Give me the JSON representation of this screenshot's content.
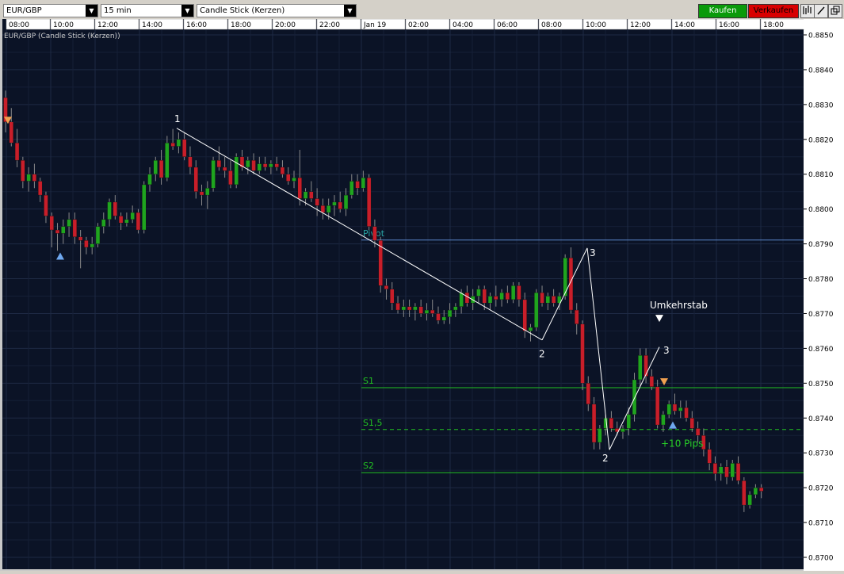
{
  "toolbar": {
    "symbol": "EUR/GBP",
    "interval": "15 min",
    "chart_type": "Candle Stick (Kerzen)",
    "buy_label": "Kaufen",
    "sell_label": "Verkaufen",
    "buy_color": "#0a9a0a",
    "sell_color": "#d80000",
    "icons": [
      "candles-icon",
      "pencil-icon",
      "popout-icon"
    ]
  },
  "chart_data": {
    "type": "candlestick",
    "title": "EUR/GBP (Candle Stick (Kerzen))",
    "background": "#0b1326",
    "up_color": "#1fa51f",
    "down_color": "#c81e2a",
    "x_ticks": [
      "08:00",
      "10:00",
      "12:00",
      "14:00",
      "16:00",
      "18:00",
      "20:00",
      "22:00",
      "Jan 19",
      "02:00",
      "04:00",
      "06:00",
      "08:00",
      "10:00",
      "12:00",
      "14:00",
      "16:00",
      "18:00"
    ],
    "y_ticks": [
      "0.8850",
      "0.8840",
      "0.8830",
      "0.8820",
      "0.8810",
      "0.8800",
      "0.8790",
      "0.8780",
      "0.8770",
      "0.8760",
      "0.8750",
      "0.8740",
      "0.8730",
      "0.8720",
      "0.8710",
      "0.8700"
    ],
    "ylim": [
      0.8698,
      0.8852
    ],
    "grid": true,
    "levels": [
      {
        "label": "Pivot",
        "value": 0.87911,
        "color": "#5b86c9",
        "dashed": false,
        "label_color": "#2aa6a6"
      },
      {
        "label": "S1",
        "value": 0.87487,
        "color": "#22c022",
        "dashed": false,
        "label_color": "#22c022"
      },
      {
        "label": "S1,5",
        "value": 0.87367,
        "color": "#22c022",
        "dashed": true,
        "label_color": "#22c022"
      },
      {
        "label": "S2",
        "value": 0.87243,
        "color": "#22c022",
        "dashed": false,
        "label_color": "#22c022"
      }
    ],
    "annotations": [
      {
        "text": "1",
        "x": "15:00",
        "value": 0.8825
      },
      {
        "text": "2",
        "x": "08:00 (Jan 19)",
        "value": 0.8759
      },
      {
        "text": "3",
        "x": "10:00 (Jan 19)",
        "value": 0.8789
      },
      {
        "text": "2",
        "x": "10:45 (Jan 19)",
        "value": 0.8728
      },
      {
        "text": "3",
        "x": "13:00 (Jan 19)",
        "value": 0.8761
      },
      {
        "text": "Umkehrstab",
        "x": "13:15 (Jan 19)",
        "value": 0.8768
      },
      {
        "text": "+10 Pips",
        "x": "14:30 (Jan 19)",
        "value": 0.8734
      }
    ],
    "zigzag": [
      [
        0.88232,
        0.87624
      ],
      [
        0.87624,
        0.87888
      ],
      [
        0.87888,
        0.87309
      ],
      [
        0.87309,
        0.87604
      ]
    ],
    "candles": [
      {
        "o": 0.8832,
        "h": 0.8834,
        "l": 0.8822,
        "c": 0.8825
      },
      {
        "o": 0.8825,
        "h": 0.8829,
        "l": 0.8818,
        "c": 0.8819
      },
      {
        "o": 0.8819,
        "h": 0.8823,
        "l": 0.8812,
        "c": 0.8814
      },
      {
        "o": 0.8814,
        "h": 0.8815,
        "l": 0.8806,
        "c": 0.8808
      },
      {
        "o": 0.8808,
        "h": 0.8812,
        "l": 0.8805,
        "c": 0.881
      },
      {
        "o": 0.881,
        "h": 0.8813,
        "l": 0.8806,
        "c": 0.8808
      },
      {
        "o": 0.8808,
        "h": 0.8809,
        "l": 0.8802,
        "c": 0.8804
      },
      {
        "o": 0.8804,
        "h": 0.8805,
        "l": 0.8796,
        "c": 0.8798
      },
      {
        "o": 0.8798,
        "h": 0.8799,
        "l": 0.8789,
        "c": 0.8794
      },
      {
        "o": 0.8794,
        "h": 0.8796,
        "l": 0.8788,
        "c": 0.8793
      },
      {
        "o": 0.8793,
        "h": 0.8797,
        "l": 0.879,
        "c": 0.8795
      },
      {
        "o": 0.8795,
        "h": 0.8799,
        "l": 0.8792,
        "c": 0.8797
      },
      {
        "o": 0.8797,
        "h": 0.8799,
        "l": 0.879,
        "c": 0.8792
      },
      {
        "o": 0.8792,
        "h": 0.8794,
        "l": 0.8783,
        "c": 0.8791
      },
      {
        "o": 0.8791,
        "h": 0.8792,
        "l": 0.8787,
        "c": 0.8789
      },
      {
        "o": 0.8789,
        "h": 0.8792,
        "l": 0.8787,
        "c": 0.879
      },
      {
        "o": 0.879,
        "h": 0.8796,
        "l": 0.8789,
        "c": 0.8795
      },
      {
        "o": 0.8795,
        "h": 0.8799,
        "l": 0.8793,
        "c": 0.8797
      },
      {
        "o": 0.8797,
        "h": 0.8803,
        "l": 0.8795,
        "c": 0.8802
      },
      {
        "o": 0.8802,
        "h": 0.8804,
        "l": 0.8797,
        "c": 0.8798
      },
      {
        "o": 0.8798,
        "h": 0.8799,
        "l": 0.8794,
        "c": 0.8796
      },
      {
        "o": 0.8796,
        "h": 0.8799,
        "l": 0.8795,
        "c": 0.8797
      },
      {
        "o": 0.8797,
        "h": 0.8801,
        "l": 0.8796,
        "c": 0.8799
      },
      {
        "o": 0.8799,
        "h": 0.88,
        "l": 0.8793,
        "c": 0.8794
      },
      {
        "o": 0.8794,
        "h": 0.8808,
        "l": 0.8793,
        "c": 0.8807
      },
      {
        "o": 0.8807,
        "h": 0.8812,
        "l": 0.8805,
        "c": 0.881
      },
      {
        "o": 0.881,
        "h": 0.8815,
        "l": 0.8808,
        "c": 0.8814
      },
      {
        "o": 0.8814,
        "h": 0.8817,
        "l": 0.8807,
        "c": 0.8809
      },
      {
        "o": 0.8809,
        "h": 0.8821,
        "l": 0.8808,
        "c": 0.8819
      },
      {
        "o": 0.8819,
        "h": 0.8823,
        "l": 0.8817,
        "c": 0.8818
      },
      {
        "o": 0.8818,
        "h": 0.8822,
        "l": 0.8816,
        "c": 0.882
      },
      {
        "o": 0.882,
        "h": 0.8822,
        "l": 0.8814,
        "c": 0.8815
      },
      {
        "o": 0.8815,
        "h": 0.8818,
        "l": 0.881,
        "c": 0.8812
      },
      {
        "o": 0.8812,
        "h": 0.8814,
        "l": 0.8803,
        "c": 0.8805
      },
      {
        "o": 0.8805,
        "h": 0.8807,
        "l": 0.8801,
        "c": 0.8804
      },
      {
        "o": 0.8804,
        "h": 0.8808,
        "l": 0.88,
        "c": 0.8806
      },
      {
        "o": 0.8806,
        "h": 0.8815,
        "l": 0.8805,
        "c": 0.8814
      },
      {
        "o": 0.8814,
        "h": 0.8818,
        "l": 0.8811,
        "c": 0.8812
      },
      {
        "o": 0.8812,
        "h": 0.8815,
        "l": 0.8809,
        "c": 0.8811
      },
      {
        "o": 0.8811,
        "h": 0.8814,
        "l": 0.8806,
        "c": 0.8807
      },
      {
        "o": 0.8807,
        "h": 0.8816,
        "l": 0.8806,
        "c": 0.8815
      },
      {
        "o": 0.8815,
        "h": 0.8817,
        "l": 0.8811,
        "c": 0.8812
      },
      {
        "o": 0.8812,
        "h": 0.8815,
        "l": 0.881,
        "c": 0.8814
      },
      {
        "o": 0.8814,
        "h": 0.8816,
        "l": 0.881,
        "c": 0.8811
      },
      {
        "o": 0.8811,
        "h": 0.8815,
        "l": 0.881,
        "c": 0.8813
      },
      {
        "o": 0.8813,
        "h": 0.8815,
        "l": 0.8811,
        "c": 0.8812
      },
      {
        "o": 0.8812,
        "h": 0.8814,
        "l": 0.881,
        "c": 0.8813
      },
      {
        "o": 0.8813,
        "h": 0.8815,
        "l": 0.8811,
        "c": 0.8812
      },
      {
        "o": 0.8812,
        "h": 0.8814,
        "l": 0.8809,
        "c": 0.881
      },
      {
        "o": 0.881,
        "h": 0.8812,
        "l": 0.8807,
        "c": 0.8808
      },
      {
        "o": 0.8808,
        "h": 0.8811,
        "l": 0.8806,
        "c": 0.8809
      },
      {
        "o": 0.8809,
        "h": 0.8817,
        "l": 0.8801,
        "c": 0.8803
      },
      {
        "o": 0.8803,
        "h": 0.8806,
        "l": 0.8801,
        "c": 0.8805
      },
      {
        "o": 0.8805,
        "h": 0.8808,
        "l": 0.8802,
        "c": 0.8803
      },
      {
        "o": 0.8803,
        "h": 0.8806,
        "l": 0.8798,
        "c": 0.8801
      },
      {
        "o": 0.8801,
        "h": 0.8803,
        "l": 0.8797,
        "c": 0.8799
      },
      {
        "o": 0.8799,
        "h": 0.8803,
        "l": 0.8797,
        "c": 0.8801
      },
      {
        "o": 0.8801,
        "h": 0.8804,
        "l": 0.8798,
        "c": 0.8802
      },
      {
        "o": 0.8802,
        "h": 0.8805,
        "l": 0.8799,
        "c": 0.88
      },
      {
        "o": 0.88,
        "h": 0.8806,
        "l": 0.8798,
        "c": 0.8804
      },
      {
        "o": 0.8804,
        "h": 0.881,
        "l": 0.8803,
        "c": 0.8808
      },
      {
        "o": 0.8808,
        "h": 0.881,
        "l": 0.8804,
        "c": 0.8806
      },
      {
        "o": 0.8806,
        "h": 0.8811,
        "l": 0.8805,
        "c": 0.8809
      },
      {
        "o": 0.8809,
        "h": 0.881,
        "l": 0.8794,
        "c": 0.8795
      },
      {
        "o": 0.8795,
        "h": 0.8797,
        "l": 0.8789,
        "c": 0.8791
      },
      {
        "o": 0.8791,
        "h": 0.8792,
        "l": 0.8776,
        "c": 0.8778
      },
      {
        "o": 0.8778,
        "h": 0.878,
        "l": 0.8774,
        "c": 0.8777
      },
      {
        "o": 0.8777,
        "h": 0.8779,
        "l": 0.8771,
        "c": 0.8773
      },
      {
        "o": 0.8773,
        "h": 0.8775,
        "l": 0.877,
        "c": 0.8771
      },
      {
        "o": 0.8771,
        "h": 0.8774,
        "l": 0.8769,
        "c": 0.8772
      },
      {
        "o": 0.8772,
        "h": 0.8774,
        "l": 0.8769,
        "c": 0.8771
      },
      {
        "o": 0.8771,
        "h": 0.8773,
        "l": 0.8768,
        "c": 0.8772
      },
      {
        "o": 0.8772,
        "h": 0.8774,
        "l": 0.8769,
        "c": 0.877
      },
      {
        "o": 0.877,
        "h": 0.8773,
        "l": 0.8768,
        "c": 0.8771
      },
      {
        "o": 0.8771,
        "h": 0.8774,
        "l": 0.8769,
        "c": 0.877
      },
      {
        "o": 0.877,
        "h": 0.8772,
        "l": 0.8767,
        "c": 0.8768
      },
      {
        "o": 0.8768,
        "h": 0.8771,
        "l": 0.8767,
        "c": 0.8769
      },
      {
        "o": 0.8769,
        "h": 0.8773,
        "l": 0.8767,
        "c": 0.8771
      },
      {
        "o": 0.8771,
        "h": 0.8773,
        "l": 0.8769,
        "c": 0.8772
      },
      {
        "o": 0.8772,
        "h": 0.8777,
        "l": 0.877,
        "c": 0.8776
      },
      {
        "o": 0.8776,
        "h": 0.8778,
        "l": 0.8772,
        "c": 0.8773
      },
      {
        "o": 0.8773,
        "h": 0.8777,
        "l": 0.8771,
        "c": 0.8775
      },
      {
        "o": 0.8775,
        "h": 0.8778,
        "l": 0.8773,
        "c": 0.8777
      },
      {
        "o": 0.8777,
        "h": 0.8778,
        "l": 0.8771,
        "c": 0.8773
      },
      {
        "o": 0.8773,
        "h": 0.8776,
        "l": 0.8771,
        "c": 0.8775
      },
      {
        "o": 0.8775,
        "h": 0.8778,
        "l": 0.8772,
        "c": 0.8774
      },
      {
        "o": 0.8774,
        "h": 0.8777,
        "l": 0.8772,
        "c": 0.8776
      },
      {
        "o": 0.8776,
        "h": 0.8778,
        "l": 0.8773,
        "c": 0.8774
      },
      {
        "o": 0.8774,
        "h": 0.8779,
        "l": 0.8773,
        "c": 0.8778
      },
      {
        "o": 0.8778,
        "h": 0.8779,
        "l": 0.8772,
        "c": 0.8774
      },
      {
        "o": 0.8774,
        "h": 0.8776,
        "l": 0.8763,
        "c": 0.8765
      },
      {
        "o": 0.8765,
        "h": 0.8767,
        "l": 0.8762,
        "c": 0.8766
      },
      {
        "o": 0.8766,
        "h": 0.8777,
        "l": 0.8765,
        "c": 0.8776
      },
      {
        "o": 0.8776,
        "h": 0.8778,
        "l": 0.8772,
        "c": 0.8773
      },
      {
        "o": 0.8773,
        "h": 0.8776,
        "l": 0.8771,
        "c": 0.8775
      },
      {
        "o": 0.8775,
        "h": 0.8777,
        "l": 0.8772,
        "c": 0.8773
      },
      {
        "o": 0.8773,
        "h": 0.8776,
        "l": 0.8771,
        "c": 0.8775
      },
      {
        "o": 0.8775,
        "h": 0.8787,
        "l": 0.8774,
        "c": 0.8786
      },
      {
        "o": 0.8786,
        "h": 0.8789,
        "l": 0.877,
        "c": 0.8771
      },
      {
        "o": 0.8771,
        "h": 0.8773,
        "l": 0.8764,
        "c": 0.8767
      },
      {
        "o": 0.8767,
        "h": 0.8768,
        "l": 0.8748,
        "c": 0.875
      },
      {
        "o": 0.875,
        "h": 0.8752,
        "l": 0.8742,
        "c": 0.8744
      },
      {
        "o": 0.8744,
        "h": 0.8746,
        "l": 0.8731,
        "c": 0.8733
      },
      {
        "o": 0.8733,
        "h": 0.8738,
        "l": 0.8731,
        "c": 0.8737
      },
      {
        "o": 0.8737,
        "h": 0.8741,
        "l": 0.8735,
        "c": 0.874
      },
      {
        "o": 0.874,
        "h": 0.8742,
        "l": 0.8736,
        "c": 0.8737
      },
      {
        "o": 0.8737,
        "h": 0.8739,
        "l": 0.8735,
        "c": 0.8736
      },
      {
        "o": 0.8736,
        "h": 0.8738,
        "l": 0.8734,
        "c": 0.8737
      },
      {
        "o": 0.8737,
        "h": 0.8743,
        "l": 0.8735,
        "c": 0.8741
      },
      {
        "o": 0.8741,
        "h": 0.8753,
        "l": 0.8739,
        "c": 0.8751
      },
      {
        "o": 0.8751,
        "h": 0.876,
        "l": 0.8749,
        "c": 0.8758
      },
      {
        "o": 0.8758,
        "h": 0.876,
        "l": 0.875,
        "c": 0.8752
      },
      {
        "o": 0.8752,
        "h": 0.8754,
        "l": 0.8748,
        "c": 0.8749
      },
      {
        "o": 0.8749,
        "h": 0.8751,
        "l": 0.8737,
        "c": 0.8738
      },
      {
        "o": 0.8738,
        "h": 0.8742,
        "l": 0.8736,
        "c": 0.8741
      },
      {
        "o": 0.8741,
        "h": 0.8745,
        "l": 0.874,
        "c": 0.8744
      },
      {
        "o": 0.8744,
        "h": 0.8747,
        "l": 0.8741,
        "c": 0.8742
      },
      {
        "o": 0.8742,
        "h": 0.8745,
        "l": 0.874,
        "c": 0.8743
      },
      {
        "o": 0.8743,
        "h": 0.8745,
        "l": 0.8739,
        "c": 0.874
      },
      {
        "o": 0.874,
        "h": 0.8742,
        "l": 0.8736,
        "c": 0.8737
      },
      {
        "o": 0.8737,
        "h": 0.8739,
        "l": 0.8733,
        "c": 0.8735
      },
      {
        "o": 0.8735,
        "h": 0.8737,
        "l": 0.8729,
        "c": 0.8731
      },
      {
        "o": 0.8731,
        "h": 0.8733,
        "l": 0.8725,
        "c": 0.8727
      },
      {
        "o": 0.8727,
        "h": 0.8729,
        "l": 0.8722,
        "c": 0.8724
      },
      {
        "o": 0.8724,
        "h": 0.8727,
        "l": 0.8722,
        "c": 0.8726
      },
      {
        "o": 0.8726,
        "h": 0.8728,
        "l": 0.8721,
        "c": 0.8723
      },
      {
        "o": 0.8723,
        "h": 0.8728,
        "l": 0.8722,
        "c": 0.8727
      },
      {
        "o": 0.8727,
        "h": 0.8729,
        "l": 0.8721,
        "c": 0.8722
      },
      {
        "o": 0.8722,
        "h": 0.8723,
        "l": 0.8713,
        "c": 0.8715
      },
      {
        "o": 0.8715,
        "h": 0.8719,
        "l": 0.8714,
        "c": 0.8718
      },
      {
        "o": 0.8718,
        "h": 0.8721,
        "l": 0.8717,
        "c": 0.872
      },
      {
        "o": 0.872,
        "h": 0.8721,
        "l": 0.8717,
        "c": 0.8719
      }
    ]
  }
}
